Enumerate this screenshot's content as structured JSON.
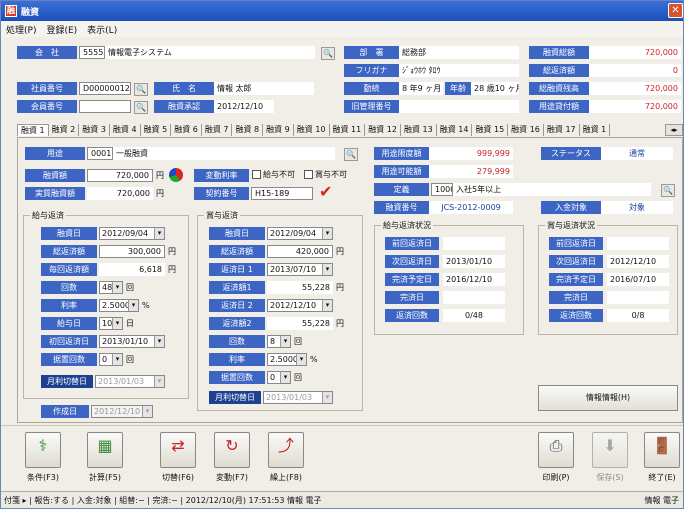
{
  "window": {
    "title": "融資",
    "close": "✕"
  },
  "menu": [
    "処理(P)",
    "登録(E)",
    "表示(L)"
  ],
  "company": {
    "label": "会　社",
    "code": "5555",
    "name": "情報電子システム"
  },
  "dept": {
    "label": "部　署",
    "value": "総務部"
  },
  "furigana": {
    "label": "フリガナ",
    "value": "ｼﾞｮｳﾎｳ ﾀﾛｳ"
  },
  "tenure": {
    "label": "勤続",
    "value": "8 年9 ヶ月",
    "age_label": "年齢",
    "age": "28 歳10 ヶ月"
  },
  "oldmgr": {
    "label": "旧管理番号",
    "value": ""
  },
  "employee": {
    "label": "社員番号",
    "value": "D000000123"
  },
  "member": {
    "label": "会員番号",
    "value": ""
  },
  "person": {
    "label": "氏　名",
    "value": "情報 太郎"
  },
  "approval": {
    "label": "融資承認",
    "value": "2012/12/10"
  },
  "summary": [
    {
      "label": "融資総額",
      "value": "720,000"
    },
    {
      "label": "総返済額",
      "value": "0"
    },
    {
      "label": "総融資残高",
      "value": "720,000"
    },
    {
      "label": "用途貸付額",
      "value": "720,000"
    }
  ],
  "tabs": [
    "融資 1",
    "融資 2",
    "融資 3",
    "融資 4",
    "融資 5",
    "融資 6",
    "融資 7",
    "融資 8",
    "融資 9",
    "融資 10",
    "融資 11",
    "融資 12",
    "融資 13",
    "融資 14",
    "融資 15",
    "融資 16",
    "融資 17",
    "融資 1"
  ],
  "purpose": {
    "label": "用途",
    "code": "0001",
    "name": "一般融資"
  },
  "loan_amount": {
    "label": "融資額",
    "value": "720,000",
    "unit": "円"
  },
  "actual_amount": {
    "label": "実質融資額",
    "value": "720,000",
    "unit": "円"
  },
  "rate_change": {
    "label": "変動利率",
    "opt1": "給与不可",
    "opt2": "賞与不可"
  },
  "contract": {
    "label": "契約番号",
    "value": "H15-189"
  },
  "limit": {
    "label": "用途限度額",
    "value": "999,999"
  },
  "available": {
    "label": "用途可能額",
    "value": "279,999"
  },
  "status_box": {
    "label": "ステータス",
    "value": "通常"
  },
  "rule": {
    "label": "定義",
    "code": "1000",
    "value": "入社5年以上"
  },
  "loan_no": {
    "label": "融資番号",
    "value": "JCS-2012-0009"
  },
  "deposit": {
    "label": "入金対象",
    "value": "対象"
  },
  "salary": {
    "title": "給与返済",
    "rows": [
      {
        "label": "融資日",
        "value": "2012/09/04"
      },
      {
        "label": "総返済額",
        "value": "300,000",
        "unit": "円"
      },
      {
        "label": "毎回返済額",
        "value": "6,618",
        "unit": "円"
      },
      {
        "label": "回数",
        "value": "48",
        "unit": "回"
      },
      {
        "label": "利率",
        "value": "2.5000",
        "unit": "%"
      },
      {
        "label": "給与日",
        "value": "10",
        "unit": "日"
      },
      {
        "label": "初回返済日",
        "value": "2013/01/10"
      },
      {
        "label": "据置回数",
        "value": "0",
        "unit": "回"
      }
    ],
    "switch_label": "月利切替日",
    "switch_value": "2013/01/03"
  },
  "bonus": {
    "title": "賞与返済",
    "rows": [
      {
        "label": "融資日",
        "value": "2012/09/04"
      },
      {
        "label": "総返済額",
        "value": "420,000",
        "unit": "円"
      },
      {
        "label": "返済日 1",
        "value": "2013/07/10"
      },
      {
        "label": "返済額1",
        "value": "55,228",
        "unit": "円"
      },
      {
        "label": "返済日 2",
        "value": "2012/12/10"
      },
      {
        "label": "返済額2",
        "value": "55,228",
        "unit": "円"
      },
      {
        "label": "回数",
        "value": "8",
        "unit": "回"
      },
      {
        "label": "利率",
        "value": "2.5000",
        "unit": "%"
      },
      {
        "label": "据置回数",
        "value": "0",
        "unit": "回"
      }
    ],
    "switch_label": "月利切替日",
    "switch_value": "2013/01/03"
  },
  "created": {
    "label": "作成日",
    "value": "2012/12/10"
  },
  "sal_status": {
    "title": "給与返済状況",
    "rows": [
      {
        "label": "前回返済日",
        "value": ""
      },
      {
        "label": "次回返済日",
        "value": "2013/01/10"
      },
      {
        "label": "完済予定日",
        "value": "2016/12/10"
      },
      {
        "label": "完済日",
        "value": ""
      },
      {
        "label": "返済回数",
        "value": "0/48"
      }
    ]
  },
  "bon_status": {
    "title": "賞与返済状況",
    "rows": [
      {
        "label": "前回返済日",
        "value": ""
      },
      {
        "label": "次回返済日",
        "value": "2012/12/10"
      },
      {
        "label": "完済予定日",
        "value": "2016/07/10"
      },
      {
        "label": "完済日",
        "value": ""
      },
      {
        "label": "返済回数",
        "value": "0/8"
      }
    ]
  },
  "info_button": "情報情報(H)",
  "toolbar": {
    "cond": "条件(F3)",
    "calc": "計算(F5)",
    "switch": "切替(F6)",
    "change": "変動(F7)",
    "early": "繰上(F8)",
    "print": "印刷(P)",
    "save": "保存(S)",
    "exit": "終了(E)"
  },
  "statusbar": "付箋 ▸ | 報告:する | 入金:対象 | 組替:− | 完済:− | 2012/12/10(月) 17:51:53 情報 電子",
  "statusbar_right": "情報 電子"
}
